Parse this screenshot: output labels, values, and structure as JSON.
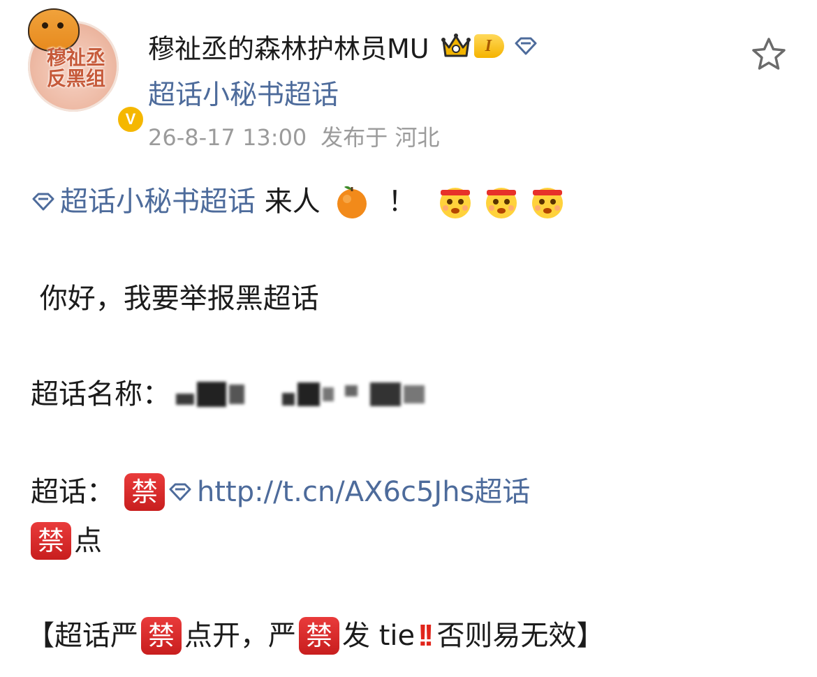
{
  "header": {
    "avatar_text": "穆祉丞\n反黑组",
    "verified_badge": "V",
    "username": "穆祉丞的森林护林员MU",
    "level": "I",
    "supertopic": "超话小秘书超话",
    "timestamp": "26-8-17 13:00",
    "location": "发布于 河北"
  },
  "post": {
    "line1": {
      "link": "超话小秘书超话",
      "text_after": " 来人 ",
      "exclaim": "！"
    },
    "line2": " 你好，我要举报黑超话",
    "line3": {
      "label": "超话名称："
    },
    "line4": {
      "label": "超话：",
      "ban": "禁",
      "link": "http://t.cn/AX6c5Jhs超话"
    },
    "line5": {
      "ban": "禁",
      "text": "点"
    },
    "line6": {
      "open_bracket": "【超话严",
      "ban1": "禁",
      "mid": "点开，严",
      "ban2": "禁",
      "after": "发 tie",
      "alert": "!!",
      "end": "否则易无效】"
    }
  },
  "colors": {
    "link": "#4d6b9b",
    "meta": "#9b9b9b",
    "ban_red": "#d32323",
    "alert_red": "#e1251b",
    "verified_gold": "#f5b700"
  },
  "icons": {
    "crown": "crown-icon",
    "diamond": "supertopic-diamond-icon",
    "star": "favorite-star-icon",
    "orange": "tangerine-emoji",
    "face": "cheer-face-emoji",
    "ban": "ban-emoji",
    "alert": "double-exclamation-emoji"
  }
}
